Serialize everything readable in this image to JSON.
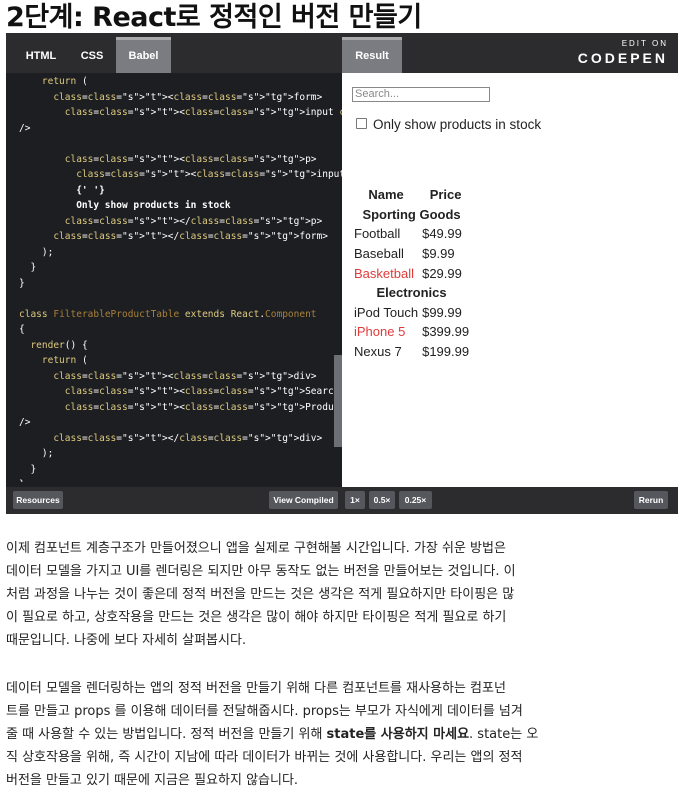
{
  "page": {
    "heading": "2단계: React로 정적인 버전 만들기"
  },
  "codepen": {
    "tabs": {
      "html": "HTML",
      "css": "CSS",
      "babel": "Babel",
      "result": "Result"
    },
    "logo_edit": "EDIT ON",
    "logo_name": "CODEPEN",
    "code_lines": [
      "    return (",
      "      <form>",
      "        <input type=\"text\" placeholder=\"Search...\"",
      "/>",
      "",
      "        <p>",
      "          <input type=\"checkbox\" />",
      "          {' '}",
      "          Only show products in stock",
      "        </p>",
      "      </form>",
      "    );",
      "  }",
      "}",
      "",
      "class FilterableProductTable extends React.Component",
      "{",
      "  render() {",
      "    return (",
      "      <div>",
      "        <SearchBar />",
      "        <ProductTable products={this.props.products}",
      "/>",
      "      </div>",
      "    );",
      "  }",
      "}"
    ],
    "bottom_buttons": {
      "resources": "Resources",
      "view_compiled": "View Compiled",
      "zoom_1x": "1×",
      "zoom_05x": "0.5×",
      "zoom_025x": "0.25×",
      "rerun": "Rerun"
    }
  },
  "result": {
    "search_placeholder": "Search...",
    "checkbox_label": "Only show products in stock",
    "table_headers": [
      "Name",
      "Price"
    ],
    "categories": [
      {
        "name": "Sporting Goods",
        "products": [
          {
            "name": "Football",
            "price": "$49.99",
            "stocked": true
          },
          {
            "name": "Baseball",
            "price": "$9.99",
            "stocked": true
          },
          {
            "name": "Basketball",
            "price": "$29.99",
            "stocked": false
          }
        ]
      },
      {
        "name": "Electronics",
        "products": [
          {
            "name": "iPod Touch",
            "price": "$99.99",
            "stocked": true
          },
          {
            "name": "iPhone 5",
            "price": "$399.99",
            "stocked": false
          },
          {
            "name": "Nexus 7",
            "price": "$199.99",
            "stocked": true
          }
        ]
      }
    ],
    "out_of_stock_color": "#e03b3b"
  },
  "body": {
    "para1": [
      "이제 컴포넌트 계층구조가 만들어졌으니 앱을 실제로 구현해볼 시간입니다. 가장 쉬운 방법은",
      "데이터 모델을 가지고 UI를 렌더링은 되지만 아무 동작도 없는 버전을 만들어보는 것입니다. 이",
      "처럼 과정을 나누는 것이 좋은데 정적 버전을 만드는 것은 생각은 적게 필요하지만 타이핑은 많",
      "이 필요로 하고, 상호작용을 만드는 것은 생각은 많이 해야 하지만 타이핑은 적게 필요로 하기",
      "때문입니다. 나중에 보다 자세히 살펴봅시다."
    ],
    "para2_lines": [
      "데이터 모델을 렌더링하는 앱의 정적 버전을 만들기 위해 다른 컴포넌트를 재사용하는 컴포넌",
      "트를 만들고 props 를 이용해 데이터를 전달해줍시다. props는 부모가 자식에게 데이터를 넘겨",
      "줄 때 사용할 수 있는 방법입니다. 정적 버전을 만들기 위해",
      "state를 사용하지 마세요",
      ". state는 오",
      "직 상호작용을 위해, 즉 시간이 지남에 따라 데이터가 바뀌는 것에 사용합니다. 우리는 앱의 정적",
      "버전을 만들고 있기 때문에 지금은 필요하지 않습니다."
    ]
  }
}
